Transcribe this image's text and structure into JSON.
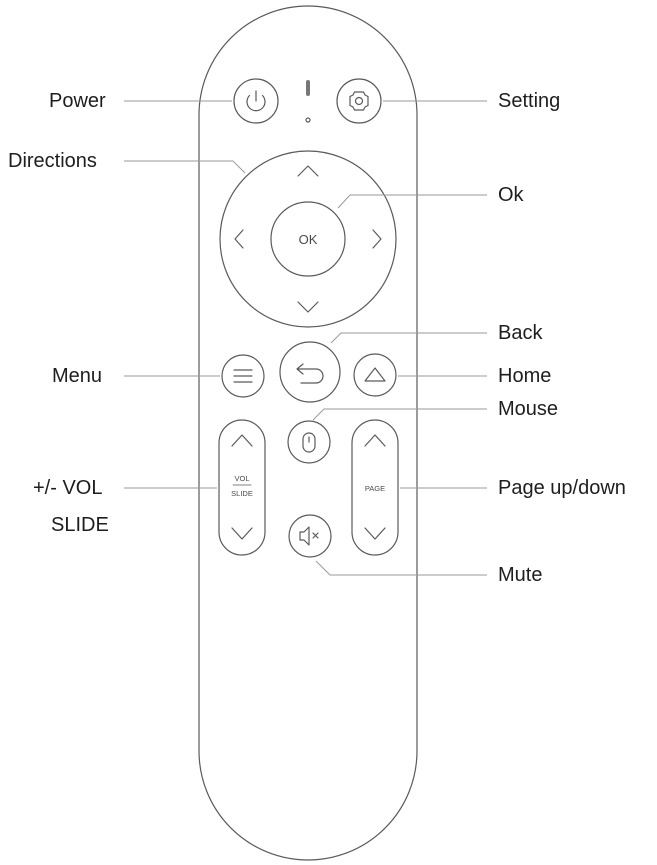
{
  "labels": {
    "power": "Power",
    "setting": "Setting",
    "directions": "Directions",
    "ok": "Ok",
    "back": "Back",
    "menu": "Menu",
    "home": "Home",
    "mouse": "Mouse",
    "vol": "+/- VOL",
    "slide": "SLIDE",
    "page": "Page up/down",
    "mute": "Mute"
  },
  "keys": {
    "ok": "OK",
    "vol": "VOL",
    "slide": "SLIDE",
    "page": "PAGE"
  },
  "colors": {
    "outline": "#5a5a5a",
    "leader": "#9a9a9a",
    "text": "#1e1e1e"
  },
  "icons": [
    "power-icon",
    "gear-icon",
    "chevron-up-icon",
    "chevron-down-icon",
    "chevron-left-icon",
    "chevron-right-icon",
    "menu-icon",
    "back-arrow-icon",
    "home-icon",
    "mouse-icon",
    "mute-icon"
  ]
}
